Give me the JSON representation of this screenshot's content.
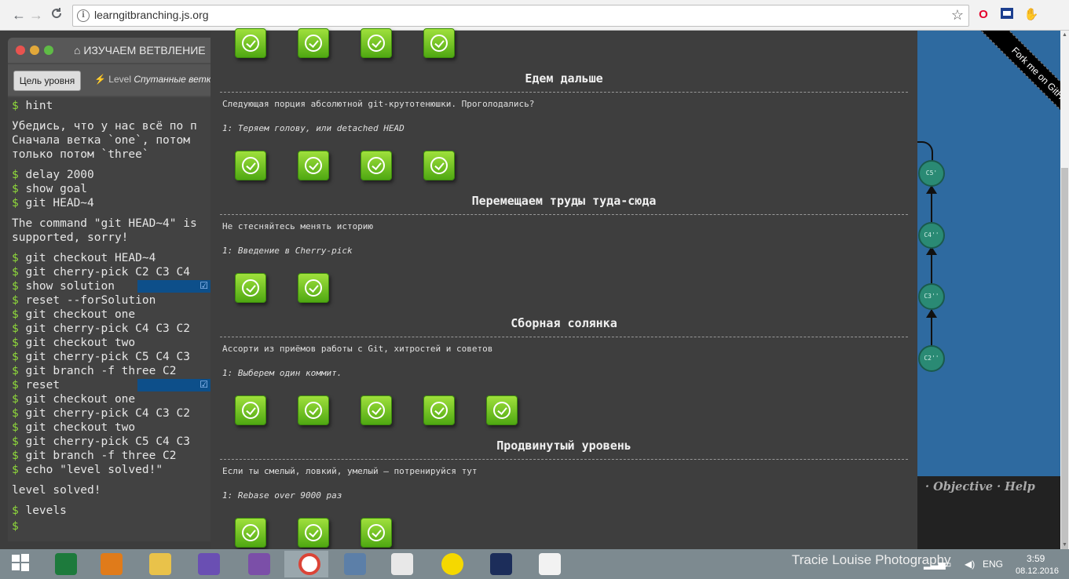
{
  "browser": {
    "url": "learngitbranching.js.org",
    "back": "←",
    "forward": "→",
    "reload": "C",
    "info_icon": "i",
    "star": "☆"
  },
  "app": {
    "window_title": "ИЗУЧАЕМ ВЕТВЛЕНИЕ",
    "goal_button": "Цель уровня",
    "level_prefix": "Level",
    "level_name": "Спутанные ветк",
    "fork_ribbon": "Fork me on GitHub",
    "help_links": "· Objective · Help",
    "colors": {
      "accent_green": "#8fd93b",
      "vis_bg": "#2e6aa0",
      "node": "#2a8a74"
    }
  },
  "terminal": {
    "prompt": "$",
    "lines": [
      {
        "cmd": "hint"
      },
      {
        "text": "Убедись, что у нас всё по п"
      },
      {
        "text": "Сначала ветка `one`, потом"
      },
      {
        "text": "только потом `three`"
      },
      {
        "cmd": "delay 2000"
      },
      {
        "cmd": "show goal"
      },
      {
        "cmd": "git HEAD~4"
      },
      {
        "text": "The command \"git HEAD~4\" is"
      },
      {
        "text": "supported, sorry!"
      },
      {
        "cmd": "git checkout HEAD~4"
      },
      {
        "cmd": "git cherry-pick C2 C3 C4"
      },
      {
        "cmd": "show solution"
      },
      {
        "cmd": "reset --forSolution"
      },
      {
        "cmd": "git checkout one"
      },
      {
        "cmd": "git cherry-pick C4 C3 C2"
      },
      {
        "cmd": "git checkout two"
      },
      {
        "cmd": "git cherry-pick C5 C4 C3"
      },
      {
        "cmd": "git branch -f three C2"
      },
      {
        "cmd": "reset"
      },
      {
        "cmd": "git checkout one"
      },
      {
        "cmd": "git cherry-pick C4 C3 C2"
      },
      {
        "cmd": "git checkout two"
      },
      {
        "cmd": "git cherry-pick C5 C4 C3"
      },
      {
        "cmd": "git branch -f three C2"
      },
      {
        "cmd": "echo \"level solved!\""
      },
      {
        "text": "level solved!"
      },
      {
        "cmd": "levels"
      },
      {
        "cmd": ""
      }
    ]
  },
  "commits": [
    "C5'",
    "C4''",
    "C3''",
    "C2''"
  ],
  "sections": [
    {
      "title": "Едем дальше",
      "description": "Следующая порция абсолютной git-крутотенюшки. Проголодались?",
      "sublevel": "1: Теряем голову, или detached HEAD",
      "completed_levels": 4
    },
    {
      "title": "Перемещаем труды туда-сюда",
      "description": "Не стесняйтесь менять историю",
      "sublevel": "1: Введение в Cherry-pick",
      "completed_levels": 2
    },
    {
      "title": "Сборная солянка",
      "description": "Ассорти из приёмов работы с Git, хитростей и советов",
      "sublevel": "1: Выберем один коммит.",
      "completed_levels": 5
    },
    {
      "title": "Продвинутый уровень",
      "description": "Если ты смелый, ловкий, умелый – потренируйся тут",
      "sublevel": "1: Rebase over 9000 раз",
      "completed_levels": 3
    }
  ],
  "taskbar": {
    "watermark": "Tracie Louise Photography",
    "lang": "ENG",
    "time": "3:59",
    "date": "08.12.2016",
    "apps": [
      "start",
      "excel",
      "media-player",
      "file-explorer",
      "visual-studio",
      "viber",
      "chrome",
      "paint-app",
      "colorful-app",
      "smiley-app",
      "moon-app",
      "image-app"
    ]
  }
}
